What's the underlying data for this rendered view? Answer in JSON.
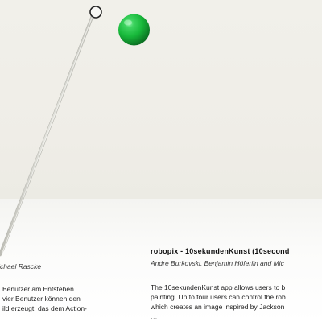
{
  "left_column": {
    "authors": "d Michael Rascke",
    "lines": [
      "Benutzer am Entstehen",
      "vier Benutzer können den",
      "ild erzeugt, das dem Action-",
      "…"
    ]
  },
  "right_column": {
    "title": "robopix - 10sekundenKunst (10second",
    "authors": "Andre Burkovski, Benjamin Höferlin and Mic",
    "lines": [
      "The 10sekundenKunst app allows users to b",
      "painting. Up to four users can control the rob",
      "which creates an image inspired by Jackson",
      "…"
    ]
  },
  "scene": {
    "ball_color": "#17b83a",
    "ball_highlight": "#7df09a",
    "ball_shadow": "#0b6f22",
    "cable_color": "#d2d2cc",
    "ring_color": "#222222",
    "background_color": "#efede7"
  }
}
